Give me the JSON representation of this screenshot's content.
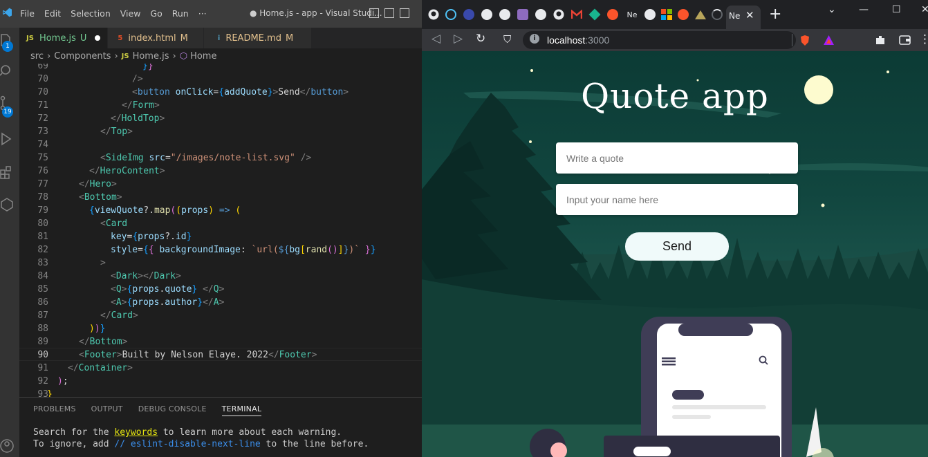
{
  "vscode": {
    "menu": [
      "File",
      "Edit",
      "Selection",
      "View",
      "Go",
      "Run",
      "···"
    ],
    "window_title": "● Home.js - app - Visual Studi...",
    "activity_badges": {
      "explorer": "1",
      "source_control": "19"
    },
    "tabs": [
      {
        "icon": "JS",
        "name": "Home.js",
        "status": "U",
        "dirty": true
      },
      {
        "icon": "5",
        "name": "index.html",
        "status": "M",
        "dirty": false
      },
      {
        "icon": "i",
        "name": "README.md",
        "status": "M",
        "dirty": false
      }
    ],
    "breadcrumb": [
      "src",
      "Components",
      "Home.js",
      "Home"
    ],
    "current_line": "90",
    "line_numbers": [
      "69",
      "70",
      "71",
      "72",
      "73",
      "74",
      "75",
      "76",
      "77",
      "78",
      "79",
      "80",
      "81",
      "82",
      "83",
      "84",
      "85",
      "86",
      "87",
      "88",
      "89",
      "90",
      "91",
      "92",
      "93"
    ],
    "panel_tabs": [
      "PROBLEMS",
      "OUTPUT",
      "DEBUG CONSOLE",
      "TERMINAL"
    ],
    "terminal": {
      "l1_a": "Search for the ",
      "l1_link": "keywords",
      "l1_b": " to learn more about each warning.",
      "l2_a": "To ignore, add ",
      "l2_cmt": "// eslint-disable-next-line",
      "l2_b": " to the line before."
    }
  },
  "browser": {
    "active_tab_label": "Ne",
    "url_host": "localhost",
    "url_port": ":3000",
    "tab_labels": [
      "Ne"
    ],
    "colors": {
      "accent": "#0078d4",
      "sky": "#0c3b35",
      "moon": "#fdfbcf"
    }
  },
  "app": {
    "title": "Quote app",
    "quote_placeholder": "Write a quote",
    "name_placeholder": "Input your name here",
    "send_label": "Send"
  }
}
